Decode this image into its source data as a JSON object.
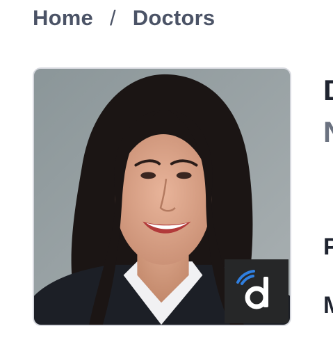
{
  "breadcrumb": {
    "items": [
      {
        "label": "Home"
      },
      {
        "label": "Doctors"
      }
    ],
    "separator": "/"
  },
  "profile": {
    "photo_badge": {
      "icon": "doximity-d-icon",
      "color": "#262728",
      "accent": "#2f7fe0"
    },
    "header_fragments": {
      "line1": "D",
      "line2": "N",
      "line3": "P",
      "line4": "M"
    }
  },
  "colors": {
    "breadcrumb_text": "#4b5366",
    "photo_border": "#d6d8de",
    "photo_background": "#9aa3a6"
  }
}
